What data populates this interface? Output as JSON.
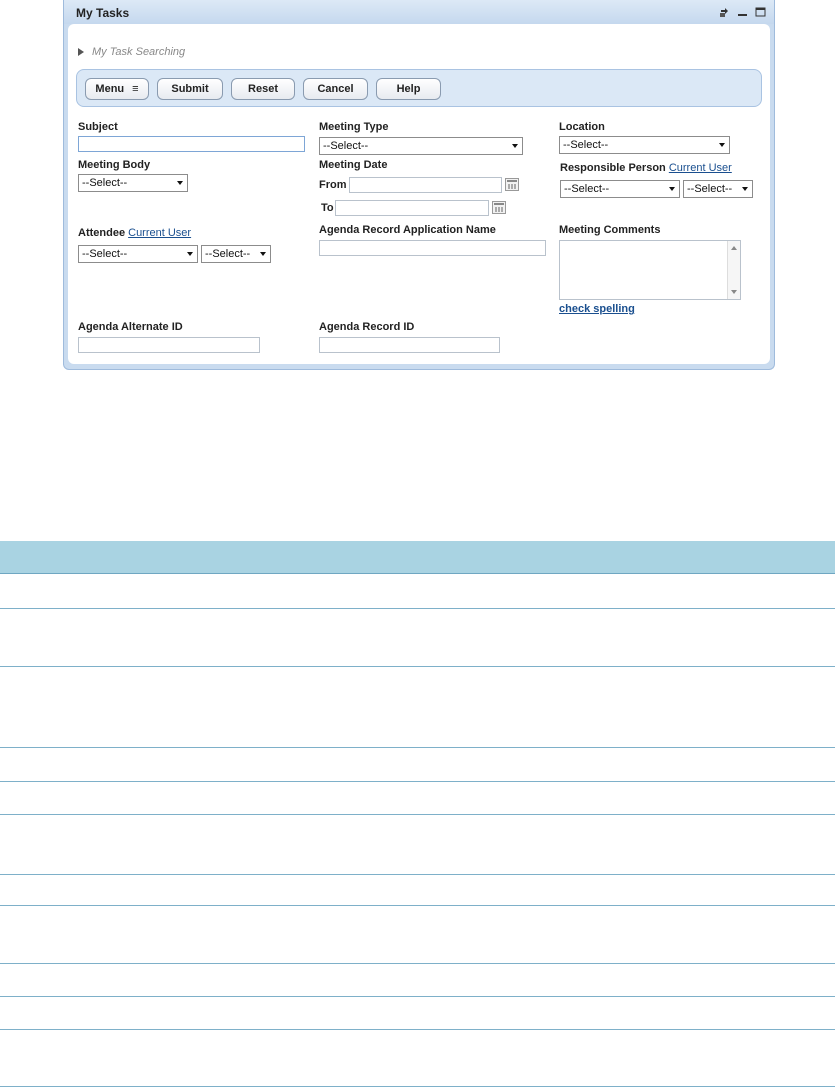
{
  "portlet": {
    "title": "My Tasks",
    "icons": [
      "refresh-icon",
      "minimize-icon",
      "maximize-icon"
    ]
  },
  "breadcrumb": {
    "label": "My Task Searching"
  },
  "toolbar": {
    "menu_label": "Menu",
    "submit_label": "Submit",
    "reset_label": "Reset",
    "cancel_label": "Cancel",
    "help_label": "Help"
  },
  "form": {
    "subject": {
      "label": "Subject",
      "value": ""
    },
    "meeting_type": {
      "label": "Meeting Type",
      "selected": "--Select--"
    },
    "location": {
      "label": "Location",
      "selected": "--Select--"
    },
    "meeting_body": {
      "label": "Meeting Body",
      "selected": "--Select--"
    },
    "meeting_date": {
      "label": "Meeting Date",
      "from_label": "From",
      "to_label": "To",
      "from_value": "",
      "to_value": ""
    },
    "responsible_person": {
      "label": "Responsible Person",
      "link": "Current User",
      "selected_1": "--Select--",
      "selected_2": "--Select--"
    },
    "attendee": {
      "label": "Attendee",
      "link": "Current User",
      "selected_1": "--Select--",
      "selected_2": "--Select--"
    },
    "agenda_record_application_name": {
      "label": "Agenda Record Application Name",
      "value": ""
    },
    "meeting_comments": {
      "label": "Meeting Comments",
      "value": "",
      "spell_link": "check spelling"
    },
    "agenda_alternate_id": {
      "label": "Agenda Alternate ID",
      "value": ""
    },
    "agenda_record_id": {
      "label": "Agenda Record ID",
      "value": ""
    }
  },
  "colors": {
    "portlet_frame": "#c9dbef",
    "toolbar_bg": "#dbe8f6",
    "link": "#1a4f8f",
    "table_header": "#a9d3e2",
    "table_rule": "#7eb0c9"
  }
}
